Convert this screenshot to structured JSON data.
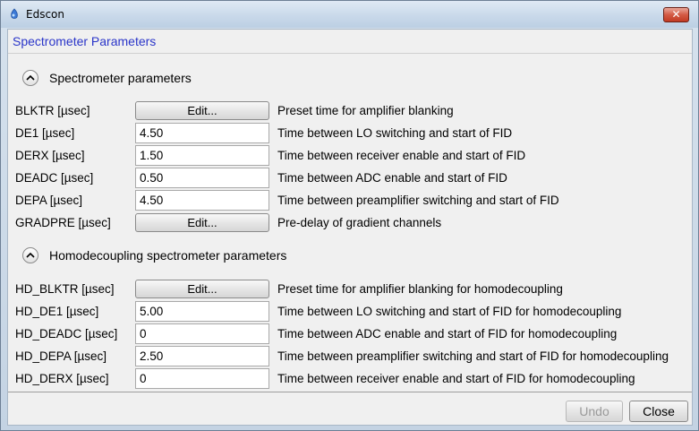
{
  "window": {
    "title": "Edscon",
    "close_glyph": "✕",
    "icon": "edscon-app-icon"
  },
  "header": {
    "title": "Spectrometer Parameters"
  },
  "sections": [
    {
      "label": "Spectrometer parameters",
      "rows": [
        {
          "label": "BLKTR [µsec]",
          "kind": "button",
          "value": "Edit...",
          "desc": "Preset time for amplifier blanking"
        },
        {
          "label": "DE1 [µsec]",
          "kind": "input",
          "value": "4.50",
          "desc": "Time between LO switching and start of FID"
        },
        {
          "label": "DERX [µsec]",
          "kind": "input",
          "value": "1.50",
          "desc": "Time between receiver enable and start of FID"
        },
        {
          "label": "DEADC [µsec]",
          "kind": "input",
          "value": "0.50",
          "desc": "Time between ADC enable and start of FID"
        },
        {
          "label": "DEPA [µsec]",
          "kind": "input",
          "value": "4.50",
          "desc": "Time between preamplifier switching and start of FID"
        },
        {
          "label": "GRADPRE [µsec]",
          "kind": "button",
          "value": "Edit...",
          "desc": "Pre-delay of gradient channels"
        }
      ]
    },
    {
      "label": "Homodecoupling spectrometer parameters",
      "rows": [
        {
          "label": "HD_BLKTR [µsec]",
          "kind": "button",
          "value": "Edit...",
          "desc": "Preset time for amplifier blanking for homodecoupling"
        },
        {
          "label": "HD_DE1 [µsec]",
          "kind": "input",
          "value": "5.00",
          "desc": "Time between LO switching and start of FID for homodecoupling"
        },
        {
          "label": "HD_DEADC [µsec]",
          "kind": "input",
          "value": "0",
          "desc": "Time between ADC enable and start of FID for homodecoupling"
        },
        {
          "label": "HD_DEPA [µsec]",
          "kind": "input",
          "value": "2.50",
          "desc": "Time between preamplifier switching and start of FID for homodecoupling"
        },
        {
          "label": "HD_DERX [µsec]",
          "kind": "input",
          "value": "0",
          "desc": "Time between receiver enable and start of FID for homodecoupling"
        }
      ]
    }
  ],
  "footer": {
    "undo_label": "Undo",
    "undo_enabled": false,
    "close_label": "Close"
  }
}
